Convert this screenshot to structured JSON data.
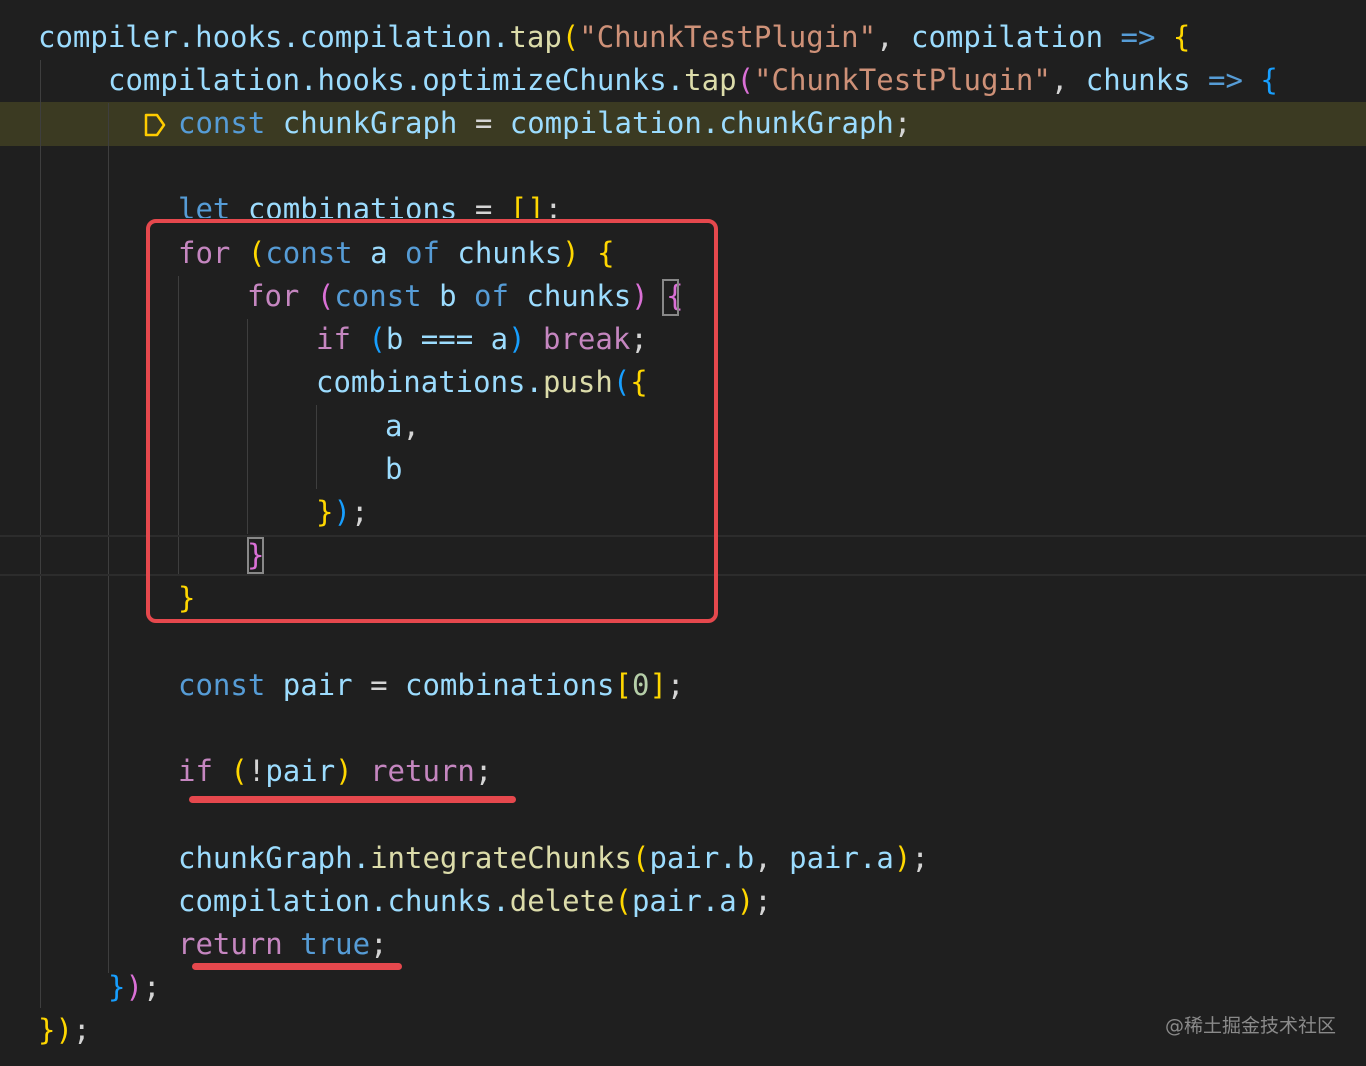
{
  "editor": {
    "lines": [
      {
        "tokens": [
          {
            "t": "compiler.hooks.compilation.",
            "c": "var"
          },
          {
            "t": "tap",
            "c": "fn"
          },
          {
            "t": "(",
            "c": "br1"
          },
          {
            "t": "\"ChunkTestPlugin\"",
            "c": "str"
          },
          {
            "t": ", ",
            "c": "punc"
          },
          {
            "t": "compilation",
            "c": "var"
          },
          {
            "t": " => ",
            "c": "kw-blue"
          },
          {
            "t": "{",
            "c": "br1"
          }
        ]
      },
      {
        "tokens": [
          {
            "t": "compilation.hooks.optimizeChunks.",
            "c": "var"
          },
          {
            "t": "tap",
            "c": "fn"
          },
          {
            "t": "(",
            "c": "br2"
          },
          {
            "t": "\"ChunkTestPlugin\"",
            "c": "str"
          },
          {
            "t": ", ",
            "c": "punc"
          },
          {
            "t": "chunks",
            "c": "var"
          },
          {
            "t": " => ",
            "c": "kw-blue"
          },
          {
            "t": "{",
            "c": "br3"
          }
        ]
      },
      {
        "tokens": [
          {
            "t": "const ",
            "c": "kw-blue"
          },
          {
            "t": "chunkGraph",
            "c": "var"
          },
          {
            "t": " = ",
            "c": "punc"
          },
          {
            "t": "compilation.chunkGraph",
            "c": "var"
          },
          {
            "t": ";",
            "c": "punc"
          }
        ]
      },
      {
        "tokens": []
      },
      {
        "tokens": [
          {
            "t": "let ",
            "c": "kw-blue"
          },
          {
            "t": "combinations",
            "c": "var"
          },
          {
            "t": " = ",
            "c": "punc"
          },
          {
            "t": "[]",
            "c": "br1"
          },
          {
            "t": ";",
            "c": "punc"
          }
        ]
      },
      {
        "tokens": [
          {
            "t": "for ",
            "c": "kw-purple"
          },
          {
            "t": "(",
            "c": "br1"
          },
          {
            "t": "const ",
            "c": "kw-blue"
          },
          {
            "t": "a ",
            "c": "var"
          },
          {
            "t": "of ",
            "c": "kw-blue"
          },
          {
            "t": "chunks",
            "c": "var"
          },
          {
            "t": ") ",
            "c": "br1"
          },
          {
            "t": "{",
            "c": "br1"
          }
        ]
      },
      {
        "tokens": [
          {
            "t": "for ",
            "c": "kw-purple"
          },
          {
            "t": "(",
            "c": "br2"
          },
          {
            "t": "const ",
            "c": "kw-blue"
          },
          {
            "t": "b ",
            "c": "var"
          },
          {
            "t": "of ",
            "c": "kw-blue"
          },
          {
            "t": "chunks",
            "c": "var"
          },
          {
            "t": ") ",
            "c": "br2"
          },
          {
            "t": "{",
            "c": "br2"
          }
        ]
      },
      {
        "tokens": [
          {
            "t": "if ",
            "c": "kw-purple"
          },
          {
            "t": "(",
            "c": "br3"
          },
          {
            "t": "b === a",
            "c": "var"
          },
          {
            "t": ") ",
            "c": "br3"
          },
          {
            "t": "break",
            "c": "kw-purple"
          },
          {
            "t": ";",
            "c": "punc"
          }
        ]
      },
      {
        "tokens": [
          {
            "t": "combinations.",
            "c": "var"
          },
          {
            "t": "push",
            "c": "fn"
          },
          {
            "t": "(",
            "c": "br3"
          },
          {
            "t": "{",
            "c": "br1"
          }
        ]
      },
      {
        "tokens": [
          {
            "t": "a",
            "c": "var"
          },
          {
            "t": ",",
            "c": "punc"
          }
        ]
      },
      {
        "tokens": [
          {
            "t": "b",
            "c": "var"
          }
        ]
      },
      {
        "tokens": [
          {
            "t": "}",
            "c": "br1"
          },
          {
            "t": ")",
            "c": "br3"
          },
          {
            "t": ";",
            "c": "punc"
          }
        ]
      },
      {
        "tokens": [
          {
            "t": "}",
            "c": "br2"
          }
        ]
      },
      {
        "tokens": [
          {
            "t": "}",
            "c": "br1"
          }
        ]
      },
      {
        "tokens": []
      },
      {
        "tokens": [
          {
            "t": "const ",
            "c": "kw-blue"
          },
          {
            "t": "pair",
            "c": "var"
          },
          {
            "t": " = ",
            "c": "punc"
          },
          {
            "t": "combinations",
            "c": "var"
          },
          {
            "t": "[",
            "c": "br1"
          },
          {
            "t": "0",
            "c": "num"
          },
          {
            "t": "]",
            "c": "br1"
          },
          {
            "t": ";",
            "c": "punc"
          }
        ]
      },
      {
        "tokens": []
      },
      {
        "tokens": [
          {
            "t": "if ",
            "c": "kw-purple"
          },
          {
            "t": "(",
            "c": "br1"
          },
          {
            "t": "!",
            "c": "punc"
          },
          {
            "t": "pair",
            "c": "var"
          },
          {
            "t": ") ",
            "c": "br1"
          },
          {
            "t": "return",
            "c": "kw-purple"
          },
          {
            "t": ";",
            "c": "punc"
          }
        ]
      },
      {
        "tokens": []
      },
      {
        "tokens": [
          {
            "t": "chunkGraph.",
            "c": "var"
          },
          {
            "t": "integrateChunks",
            "c": "fn"
          },
          {
            "t": "(",
            "c": "br1"
          },
          {
            "t": "pair.b",
            "c": "var"
          },
          {
            "t": ", ",
            "c": "punc"
          },
          {
            "t": "pair.a",
            "c": "var"
          },
          {
            "t": ")",
            "c": "br1"
          },
          {
            "t": ";",
            "c": "punc"
          }
        ]
      },
      {
        "tokens": [
          {
            "t": "compilation.chunks.",
            "c": "var"
          },
          {
            "t": "delete",
            "c": "fn"
          },
          {
            "t": "(",
            "c": "br1"
          },
          {
            "t": "pair.a",
            "c": "var"
          },
          {
            "t": ")",
            "c": "br1"
          },
          {
            "t": ";",
            "c": "punc"
          }
        ]
      },
      {
        "tokens": [
          {
            "t": "return ",
            "c": "kw-purple"
          },
          {
            "t": "true",
            "c": "kw-blue"
          },
          {
            "t": ";",
            "c": "punc"
          }
        ]
      },
      {
        "tokens": [
          {
            "t": "}",
            "c": "br3"
          },
          {
            "t": ")",
            "c": "br2"
          },
          {
            "t": ";",
            "c": "punc"
          }
        ]
      },
      {
        "tokens": [
          {
            "t": "}",
            "c": "br1"
          },
          {
            "t": ")",
            "c": "br1"
          },
          {
            "t": ";",
            "c": "punc"
          }
        ]
      }
    ]
  },
  "watermark": "@稀土掘金技术社区",
  "colors": {
    "annotation": "#e5484d",
    "highlight_line": "#3b3a22",
    "background": "#1f1f1f"
  },
  "icons": {
    "breakpoint": "breakpoint-arrow-icon"
  }
}
